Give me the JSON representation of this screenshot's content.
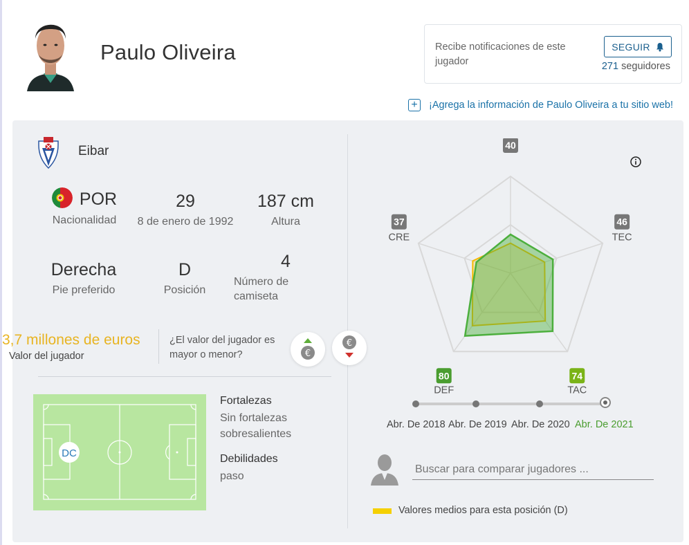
{
  "player": {
    "name": "Paulo Oliveira"
  },
  "notifications": {
    "text": "Recibe notificaciones de este jugador",
    "follow_label": "SEGUIR",
    "follower_count": "271",
    "follower_suffix": "seguidores"
  },
  "add_info_link": "¡Agrega la información de Paulo Oliveira a tu sitio web!",
  "club": {
    "name": "Eibar"
  },
  "stats": {
    "nationality": {
      "value": "POR",
      "label": "Nacionalidad"
    },
    "age": {
      "value": "29",
      "label": "8 de enero de 1992"
    },
    "height": {
      "value": "187 cm",
      "label": "Altura"
    },
    "foot": {
      "value": "Derecha",
      "label": "Pie preferido"
    },
    "position": {
      "value": "D",
      "label": "Posición"
    },
    "shirt": {
      "value": "4",
      "label": "Número de camiseta"
    }
  },
  "market": {
    "value": "3,7 millones de euros",
    "label": "Valor del jugador",
    "question": "¿El valor del jugador es mayor o menor?"
  },
  "pitch": {
    "position_label": "DC"
  },
  "strengths": {
    "title": "Fortalezas",
    "text": "Sin fortalezas sobresalientes"
  },
  "weaknesses": {
    "title": "Debilidades",
    "text": "paso"
  },
  "radar": {
    "attributes": [
      {
        "key": "ATT",
        "value": 40,
        "color": "#777777"
      },
      {
        "key": "TEC",
        "value": 46,
        "color": "#777777"
      },
      {
        "key": "TAC",
        "value": 74,
        "color": "#7ab317"
      },
      {
        "key": "DEF",
        "value": 80,
        "color": "#4a9d2f"
      },
      {
        "key": "CRE",
        "value": 37,
        "color": "#777777"
      }
    ],
    "average_values": [
      31,
      37,
      61,
      67,
      41
    ],
    "player_color": "#4caf3d",
    "average_color": "#f5b800"
  },
  "timeline": {
    "labels": [
      "Abr. De 2018",
      "Abr. De 2019",
      "Abr. De 2020",
      "Abr. De 2021"
    ],
    "active_index": 3
  },
  "compare": {
    "placeholder": "Buscar para comparar jugadores ..."
  },
  "legend": {
    "text": "Valores medios para esta posición (D)",
    "color": "#f5d000"
  }
}
